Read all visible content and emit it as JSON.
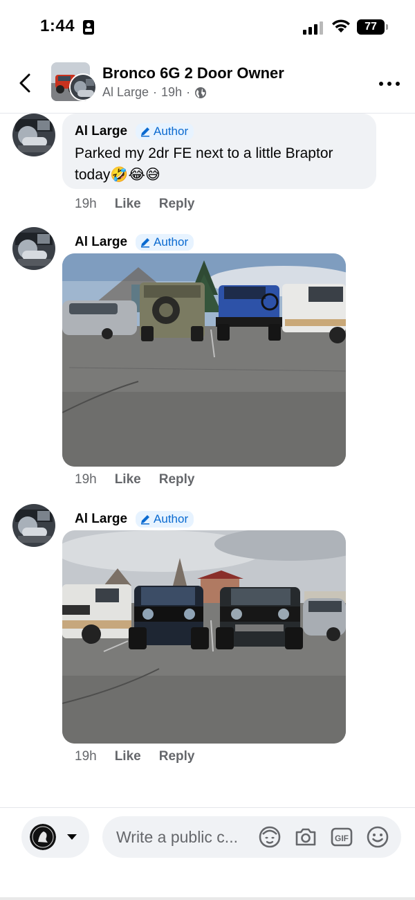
{
  "status_bar": {
    "time": "1:44",
    "battery": "77"
  },
  "header": {
    "group_name": "Bronco 6G 2 Door Owner",
    "author": "Al Large",
    "separator": "·",
    "posted_ago": "19h",
    "privacy_icon": "globe-icon"
  },
  "comments": [
    {
      "name": "Al Large",
      "badge": "Author",
      "text": "Parked my 2dr FE next to a little Braptor today🤣😂😅",
      "time": "19h",
      "like": "Like",
      "reply": "Reply"
    },
    {
      "name": "Al Large",
      "badge": "Author",
      "photo": "parking-lot-photo",
      "time": "19h",
      "like": "Like",
      "reply": "Reply"
    },
    {
      "name": "Al Large",
      "badge": "Author",
      "photo": "two-broncos-front-photo",
      "time": "19h",
      "like": "Like",
      "reply": "Reply"
    }
  ],
  "composer": {
    "placeholder": "Write a public c...",
    "icons": [
      "avatar-sticker-icon",
      "camera-icon",
      "gif-icon",
      "emoji-icon"
    ]
  },
  "colors": {
    "accent": "#0a6ad0",
    "bubble": "#f0f2f5",
    "meta": "#65676b"
  }
}
